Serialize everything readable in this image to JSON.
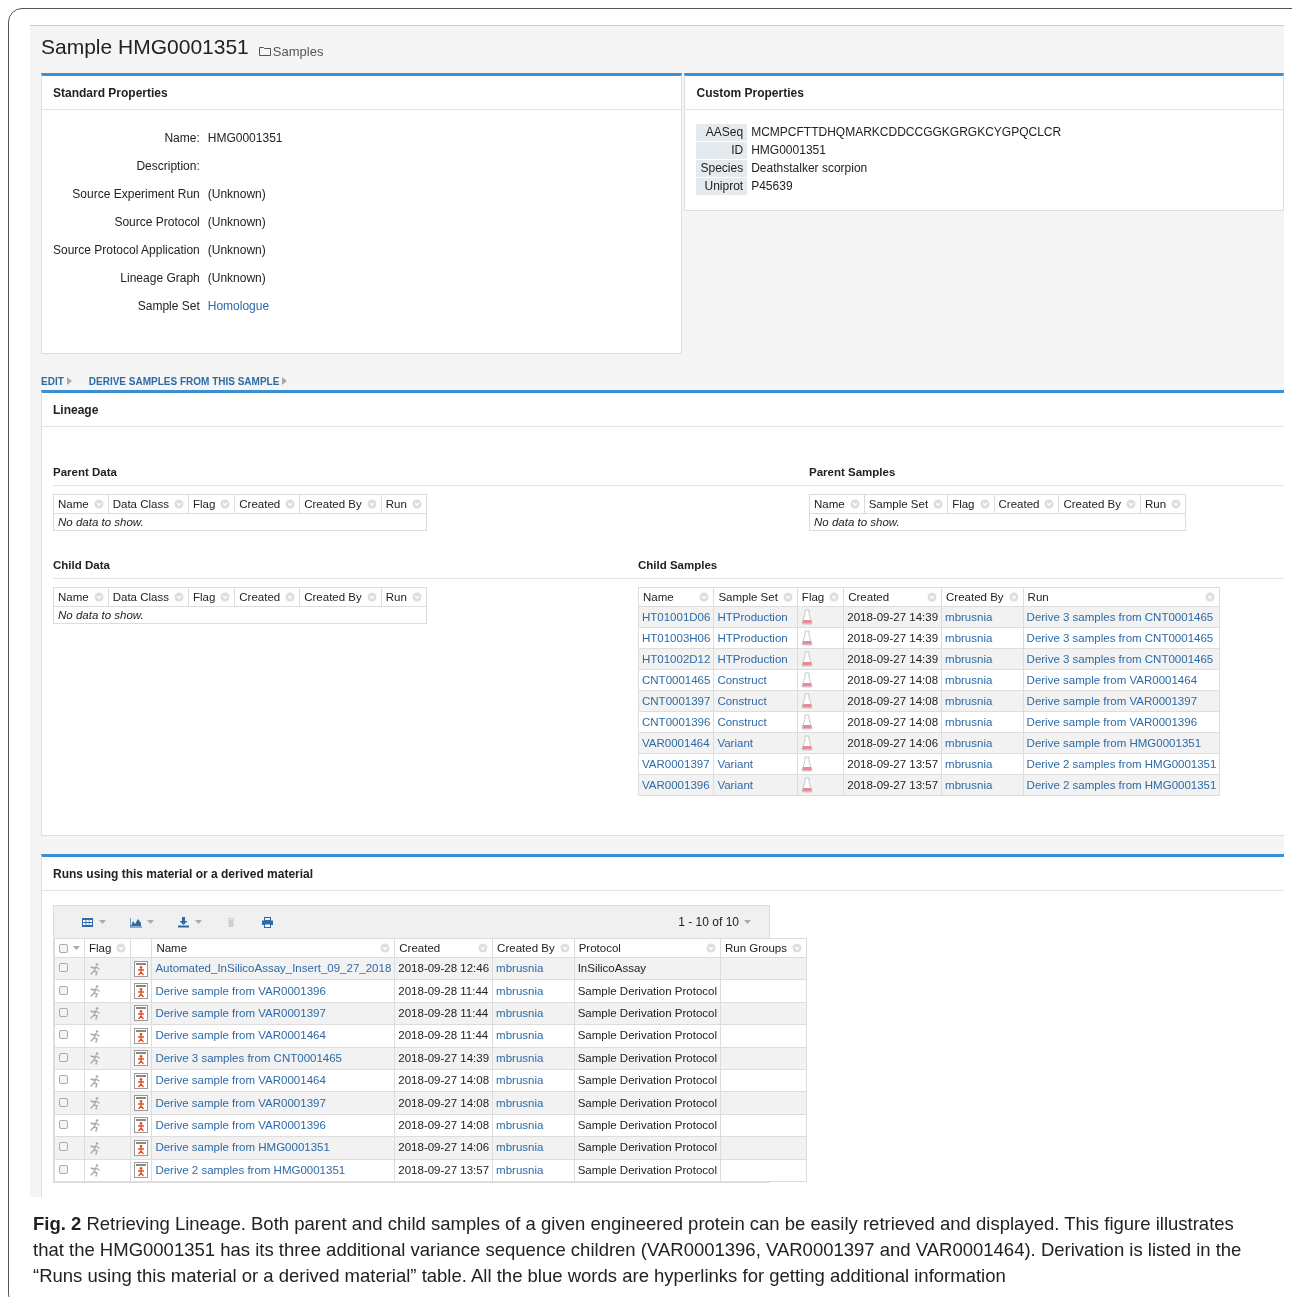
{
  "header": {
    "title": "Sample HMG0001351",
    "breadcrumb": "Samples"
  },
  "standard_properties": {
    "title": "Standard Properties",
    "rows": [
      {
        "label": "Name:",
        "value": "HMG0001351",
        "link": false
      },
      {
        "label": "Description:"
      },
      {
        "label": "Source Experiment Run",
        "value": "(Unknown)",
        "link": false
      },
      {
        "label": "Source Protocol",
        "value": "(Unknown)",
        "link": false
      },
      {
        "label": "Source Protocol Application",
        "value": "(Unknown)",
        "link": false
      },
      {
        "label": "Lineage Graph",
        "value": "(Unknown)",
        "link": false
      },
      {
        "label": "Sample Set",
        "value": "Homologue",
        "link": true
      }
    ]
  },
  "custom_properties": {
    "title": "Custom Properties",
    "rows": [
      {
        "label": "AASeq",
        "value": "MCMPCFTTDHQMARKCDDCCGGKGRGKCYGPQCLCR"
      },
      {
        "label": "ID",
        "value": "HMG0001351"
      },
      {
        "label": "Species",
        "value": "Deathstalker scorpion"
      },
      {
        "label": "Uniprot",
        "value": "P45639"
      }
    ]
  },
  "actions": [
    {
      "label": "EDIT"
    },
    {
      "label": "DERIVE SAMPLES FROM THIS SAMPLE"
    }
  ],
  "lineage": {
    "title": "Lineage",
    "sections": [
      {
        "title": "Parent Data",
        "columns": [
          {
            "label": "Name"
          },
          {
            "label": "Data Class"
          },
          {
            "label": "Flag"
          },
          {
            "label": "Created"
          },
          {
            "label": "Created By"
          },
          {
            "label": "Run"
          }
        ],
        "empty_message": "No data to show."
      },
      {
        "title": "Parent Samples",
        "columns": [
          {
            "label": "Name"
          },
          {
            "label": "Sample Set"
          },
          {
            "label": "Flag"
          },
          {
            "label": "Created"
          },
          {
            "label": "Created By"
          },
          {
            "label": "Run"
          }
        ],
        "empty_message": "No data to show."
      },
      {
        "title": "Child Data",
        "columns": [
          {
            "label": "Name"
          },
          {
            "label": "Data Class"
          },
          {
            "label": "Flag"
          },
          {
            "label": "Created"
          },
          {
            "label": "Created By"
          },
          {
            "label": "Run"
          }
        ],
        "empty_message": "No data to show."
      },
      {
        "title": "Child Samples",
        "columns": [
          {
            "label": "Name",
            "kind": "link"
          },
          {
            "label": "Sample Set",
            "kind": "link"
          },
          {
            "label": "Flag",
            "kind": "flag"
          },
          {
            "label": "Created",
            "kind": "text"
          },
          {
            "label": "Created By",
            "kind": "link"
          },
          {
            "label": "Run",
            "kind": "link"
          }
        ],
        "rows": [
          [
            "HT01001D06",
            "HTProduction",
            "",
            "2018-09-27 14:39",
            "mbrusnia",
            "Derive 3 samples from CNT0001465"
          ],
          [
            "HT01003H06",
            "HTProduction",
            "",
            "2018-09-27 14:39",
            "mbrusnia",
            "Derive 3 samples from CNT0001465"
          ],
          [
            "HT01002D12",
            "HTProduction",
            "",
            "2018-09-27 14:39",
            "mbrusnia",
            "Derive 3 samples from CNT0001465"
          ],
          [
            "CNT0001465",
            "Construct",
            "",
            "2018-09-27 14:08",
            "mbrusnia",
            "Derive sample from VAR0001464"
          ],
          [
            "CNT0001397",
            "Construct",
            "",
            "2018-09-27 14:08",
            "mbrusnia",
            "Derive sample from VAR0001397"
          ],
          [
            "CNT0001396",
            "Construct",
            "",
            "2018-09-27 14:08",
            "mbrusnia",
            "Derive sample from VAR0001396"
          ],
          [
            "VAR0001464",
            "Variant",
            "",
            "2018-09-27 14:06",
            "mbrusnia",
            "Derive sample from HMG0001351"
          ],
          [
            "VAR0001397",
            "Variant",
            "",
            "2018-09-27 13:57",
            "mbrusnia",
            "Derive 2 samples from HMG0001351"
          ],
          [
            "VAR0001396",
            "Variant",
            "",
            "2018-09-27 13:57",
            "mbrusnia",
            "Derive 2 samples from HMG0001351"
          ]
        ]
      }
    ]
  },
  "runs": {
    "title": "Runs using this material or a derived material",
    "toolbar": [
      {
        "kind": "grid",
        "dropdown": true,
        "disabled": false
      },
      {
        "kind": "chart",
        "dropdown": true,
        "disabled": false
      },
      {
        "kind": "export",
        "dropdown": true,
        "disabled": false
      },
      {
        "kind": "delete",
        "dropdown": false,
        "disabled": true
      },
      {
        "kind": "print",
        "dropdown": false,
        "disabled": false
      }
    ],
    "pagination": "1 - 10 of 10",
    "select_all": {
      "checked": false
    },
    "columns": [
      {
        "kind": "select"
      },
      {
        "label": "Flag",
        "kind": "flag"
      },
      {
        "kind": "run_icon"
      },
      {
        "label": "Name",
        "kind": "link"
      },
      {
        "label": "Created",
        "kind": "text"
      },
      {
        "label": "Created By",
        "kind": "link"
      },
      {
        "label": "Protocol",
        "kind": "text"
      },
      {
        "label": "Run Groups",
        "kind": "text"
      }
    ],
    "rows": [
      {
        "checked": false,
        "cells": [
          "",
          "",
          "",
          "Automated_InSilicoAssay_Insert_09_27_2018",
          "2018-09-28 12:46",
          "mbrusnia",
          "InSilicoAssay",
          ""
        ]
      },
      {
        "checked": false,
        "cells": [
          "",
          "",
          "",
          "Derive sample from VAR0001396",
          "2018-09-28 11:44",
          "mbrusnia",
          "Sample Derivation Protocol",
          ""
        ]
      },
      {
        "checked": false,
        "cells": [
          "",
          "",
          "",
          "Derive sample from VAR0001397",
          "2018-09-28 11:44",
          "mbrusnia",
          "Sample Derivation Protocol",
          ""
        ]
      },
      {
        "checked": false,
        "cells": [
          "",
          "",
          "",
          "Derive sample from VAR0001464",
          "2018-09-28 11:44",
          "mbrusnia",
          "Sample Derivation Protocol",
          ""
        ]
      },
      {
        "checked": false,
        "cells": [
          "",
          "",
          "",
          "Derive 3 samples from CNT0001465",
          "2018-09-27 14:39",
          "mbrusnia",
          "Sample Derivation Protocol",
          ""
        ]
      },
      {
        "checked": false,
        "cells": [
          "",
          "",
          "",
          "Derive sample from VAR0001464",
          "2018-09-27 14:08",
          "mbrusnia",
          "Sample Derivation Protocol",
          ""
        ]
      },
      {
        "checked": false,
        "cells": [
          "",
          "",
          "",
          "Derive sample from VAR0001397",
          "2018-09-27 14:08",
          "mbrusnia",
          "Sample Derivation Protocol",
          ""
        ]
      },
      {
        "checked": false,
        "cells": [
          "",
          "",
          "",
          "Derive sample from VAR0001396",
          "2018-09-27 14:08",
          "mbrusnia",
          "Sample Derivation Protocol",
          ""
        ]
      },
      {
        "checked": false,
        "cells": [
          "",
          "",
          "",
          "Derive sample from HMG0001351",
          "2018-09-27 14:06",
          "mbrusnia",
          "Sample Derivation Protocol",
          ""
        ]
      },
      {
        "checked": false,
        "cells": [
          "",
          "",
          "",
          "Derive 2 samples from HMG0001351",
          "2018-09-27 13:57",
          "mbrusnia",
          "Sample Derivation Protocol",
          ""
        ]
      }
    ]
  },
  "caption": "**Fig. 2** Retrieving Lineage. Both parent and child samples of a given engineered protein can be easily retrieved and displayed. This figure illustrates that the HMG0001351 has its three additional variance sequence children (VAR0001396, VAR0001397 and VAR0001464). Derivation is listed in the “Runs using this material or a derived material” table. All the blue words are hyperlinks for getting additional information"
}
